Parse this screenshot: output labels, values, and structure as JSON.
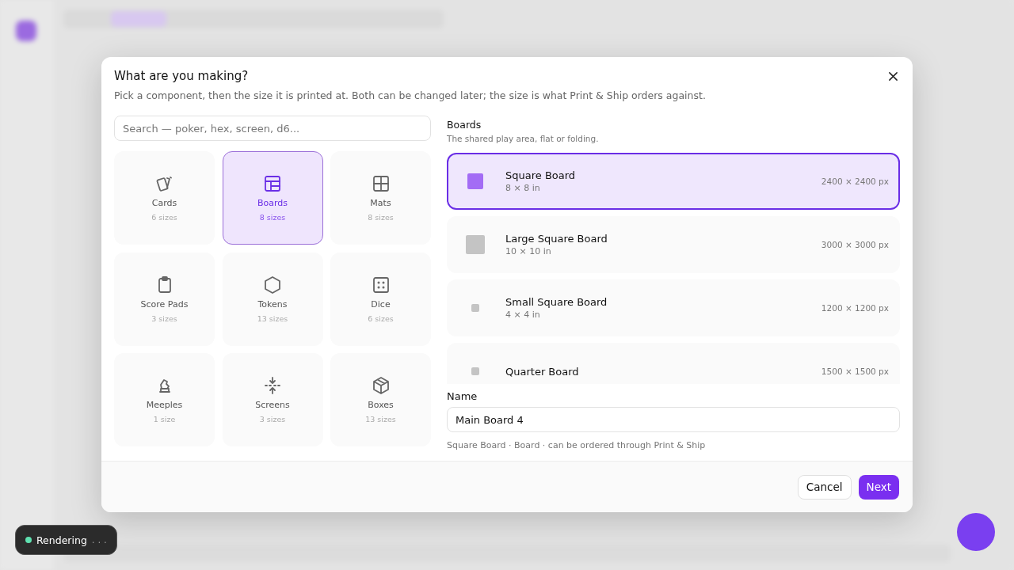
{
  "dialog": {
    "title": "What are you making?",
    "subtitle": "Pick a component, then the size it is printed at. Both can be changed later; the size is what Print & Ship orders against.",
    "search": {
      "placeholder": "Search — poker, hex, screen, d6..."
    },
    "categories": [
      {
        "kind": "cards",
        "label": "Cards",
        "count": "6 sizes",
        "selected": false
      },
      {
        "kind": "boards",
        "label": "Boards",
        "count": "8 sizes",
        "selected": true
      },
      {
        "kind": "mats",
        "label": "Mats",
        "count": "8 sizes",
        "selected": false
      },
      {
        "kind": "scorepads",
        "label": "Score Pads",
        "count": "3 sizes",
        "selected": false
      },
      {
        "kind": "tokens",
        "label": "Tokens",
        "count": "13 sizes",
        "selected": false
      },
      {
        "kind": "dice",
        "label": "Dice",
        "count": "6 sizes",
        "selected": false
      },
      {
        "kind": "meeples",
        "label": "Meeples",
        "count": "1 size",
        "selected": false
      },
      {
        "kind": "screens",
        "label": "Screens",
        "count": "3 sizes",
        "selected": false
      },
      {
        "kind": "boxes",
        "label": "Boxes",
        "count": "13 sizes",
        "selected": false
      }
    ],
    "group": {
      "title": "Boards",
      "description": "The shared play area, flat or folding."
    },
    "sizes": [
      {
        "kind": "medium",
        "name": "Square Board",
        "dims": "8 × 8 in",
        "pixels": "2400 × 2400 px",
        "selected": true
      },
      {
        "kind": "large",
        "name": "Large Square Board",
        "dims": "10 × 10 in",
        "pixels": "3000 × 3000 px",
        "selected": false
      },
      {
        "kind": "small",
        "name": "Small Square Board",
        "dims": "4 × 4 in",
        "pixels": "1200 × 1200 px",
        "selected": false
      },
      {
        "kind": "small",
        "name": "Quarter Board",
        "pixels": "1500 × 1500 px",
        "selected": false
      }
    ],
    "name_label": "Name",
    "name_value": "Main Board 4",
    "hint": "Square Board · Board · can be ordered through Print & Ship",
    "buttons": [
      {
        "kind": "secondary",
        "label": "Cancel"
      },
      {
        "kind": "primary",
        "label": "Next"
      }
    ]
  },
  "toast": {
    "label": "Rendering",
    "dots": ". . ."
  }
}
